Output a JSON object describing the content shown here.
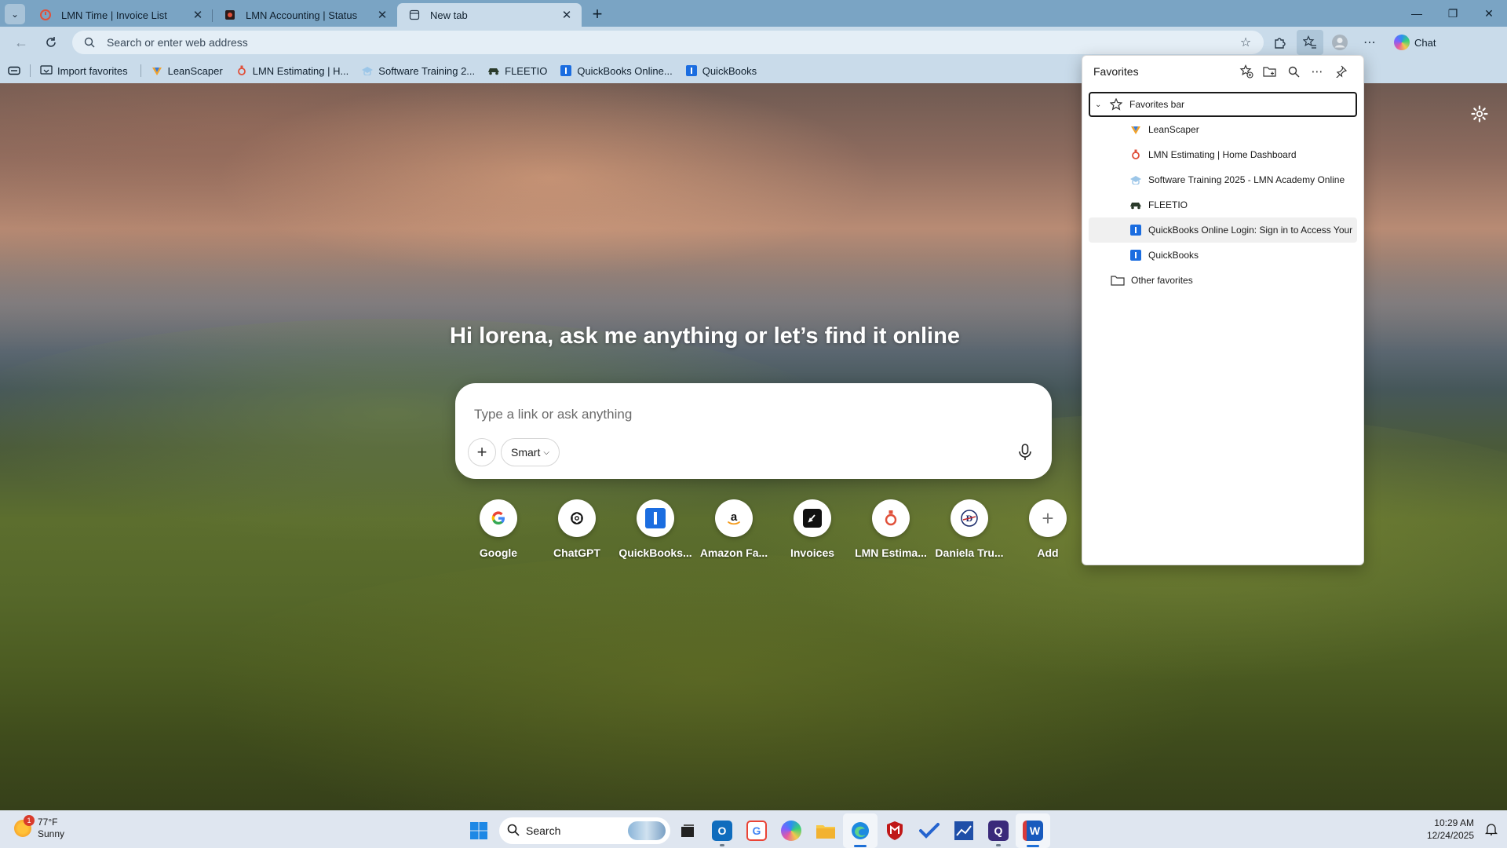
{
  "tabs": [
    {
      "title": "LMN Time | Invoice List",
      "icon": "lmn-time-icon"
    },
    {
      "title": "LMN Accounting | Status",
      "icon": "lmn-accounting-icon"
    },
    {
      "title": "New tab",
      "icon": "newtab-icon"
    }
  ],
  "address": {
    "placeholder": "Search or enter web address"
  },
  "chat_label": "Chat",
  "favbar": {
    "import": "Import favorites",
    "items": [
      "LeanScaper",
      "LMN Estimating | H...",
      "Software Training 2...",
      "FLEETIO",
      "QuickBooks Online...",
      "QuickBooks"
    ]
  },
  "page": {
    "greeting": "Hi lorena, ask me anything or let’s find it online",
    "search_placeholder": "Type a link or ask anything",
    "smart_label": "Smart"
  },
  "quicklinks": [
    "Google",
    "ChatGPT",
    "QuickBooks...",
    "Amazon Fa...",
    "Invoices",
    "LMN Estima...",
    "Daniela Tru...",
    "Add"
  ],
  "favorites_panel": {
    "title": "Favorites",
    "root": "Favorites bar",
    "items": [
      "LeanScaper",
      "LMN Estimating | Home Dashboard",
      "Software Training 2025 - LMN Academy Online",
      "FLEETIO",
      "QuickBooks Online Login: Sign in to Access Your",
      "QuickBooks"
    ],
    "other": "Other favorites"
  },
  "taskbar": {
    "weather_temp": "77°F",
    "weather_desc": "Sunny",
    "weather_badge": "1",
    "search": "Search",
    "time": "10:29 AM",
    "date": "12/24/2025"
  },
  "colors": {
    "tabstrip": "#7aa4c4",
    "toolbar": "#c9dbea",
    "accent": "#1d6fd6",
    "quickbooks": "#1b6de0",
    "lmn": "#e0503a"
  }
}
